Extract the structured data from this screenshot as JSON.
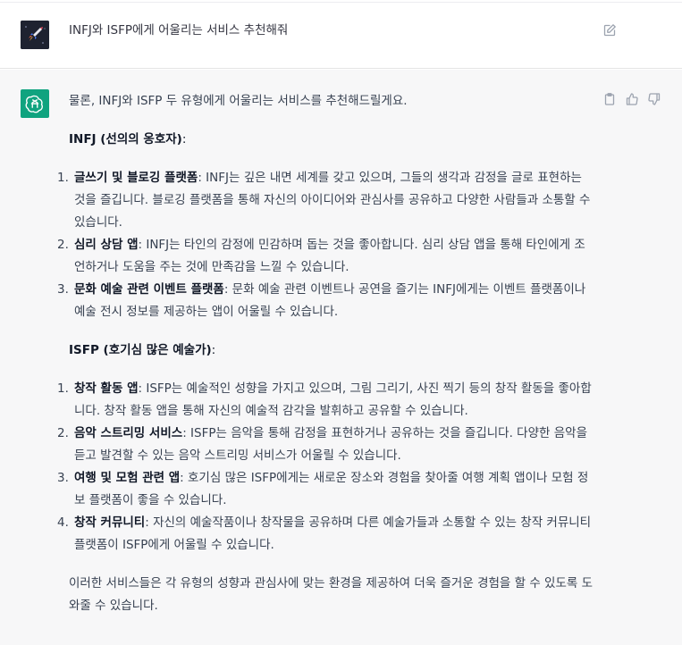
{
  "user_message": {
    "text": "INFJ와 ISFP에게 어울리는 서비스 추천해줘"
  },
  "assistant_message": {
    "intro": "물론, INFJ와 ISFP 두 유형에게 어울리는 서비스를 추천해드릴게요.",
    "sections": [
      {
        "title": "INFJ (선의의 옹호자)",
        "colon": ":",
        "items": [
          {
            "num": "1.",
            "title": "글쓰기 및 블로깅 플랫폼",
            "text": ": INFJ는 깊은 내면 세계를 갖고 있으며, 그들의 생각과 감정을 글로 표현하는 것을 즐깁니다. 블로깅 플랫폼을 통해 자신의 아이디어와 관심사를 공유하고 다양한 사람들과 소통할 수 있습니다."
          },
          {
            "num": "2.",
            "title": "심리 상담 앱",
            "text": ": INFJ는 타인의 감정에 민감하며 돕는 것을 좋아합니다. 심리 상담 앱을 통해 타인에게 조언하거나 도움을 주는 것에 만족감을 느낄 수 있습니다."
          },
          {
            "num": "3.",
            "title": "문화 예술 관련 이벤트 플랫폼",
            "text": ": 문화 예술 관련 이벤트나 공연을 즐기는 INFJ에게는 이벤트 플랫폼이나 예술 전시 정보를 제공하는 앱이 어울릴 수 있습니다."
          }
        ]
      },
      {
        "title": "ISFP (호기심 많은 예술가)",
        "colon": ":",
        "items": [
          {
            "num": "1.",
            "title": "창작 활동 앱",
            "text": ": ISFP는 예술적인 성향을 가지고 있으며, 그림 그리기, 사진 찍기 등의 창작 활동을 좋아합니다. 창작 활동 앱을 통해 자신의 예술적 감각을 발휘하고 공유할 수 있습니다."
          },
          {
            "num": "2.",
            "title": "음악 스트리밍 서비스",
            "text": ": ISFP는 음악을 통해 감정을 표현하거나 공유하는 것을 즐깁니다. 다양한 음악을 듣고 발견할 수 있는 음악 스트리밍 서비스가 어울릴 수 있습니다."
          },
          {
            "num": "3.",
            "title": "여행 및 모험 관련 앱",
            "text": ": 호기심 많은 ISFP에게는 새로운 장소와 경험을 찾아줄 여행 계획 앱이나 모험 정보 플랫폼이 좋을 수 있습니다."
          },
          {
            "num": "4.",
            "title": "창작 커뮤니티",
            "text": ": 자신의 예술작품이나 창작물을 공유하며 다른 예술가들과 소통할 수 있는 창작 커뮤니티 플랫폼이 ISFP에게 어울릴 수 있습니다."
          }
        ]
      }
    ],
    "outro": "이러한 서비스들은 각 유형의 성향과 관심사에 맞는 환경을 제공하여 더욱 즐거운 경험을 할 수 있도록 도와줄 수 있습니다."
  },
  "icons": {
    "user_avatar": "rocket-avatar-icon",
    "assistant_avatar": "openai-logo-icon",
    "edit": "edit-icon",
    "copy": "clipboard-icon",
    "like": "thumbs-up-icon",
    "dislike": "thumbs-down-icon"
  },
  "colors": {
    "assistant_bg": "#f7f7f8",
    "avatar_green": "#10a37f",
    "text": "#374151"
  }
}
